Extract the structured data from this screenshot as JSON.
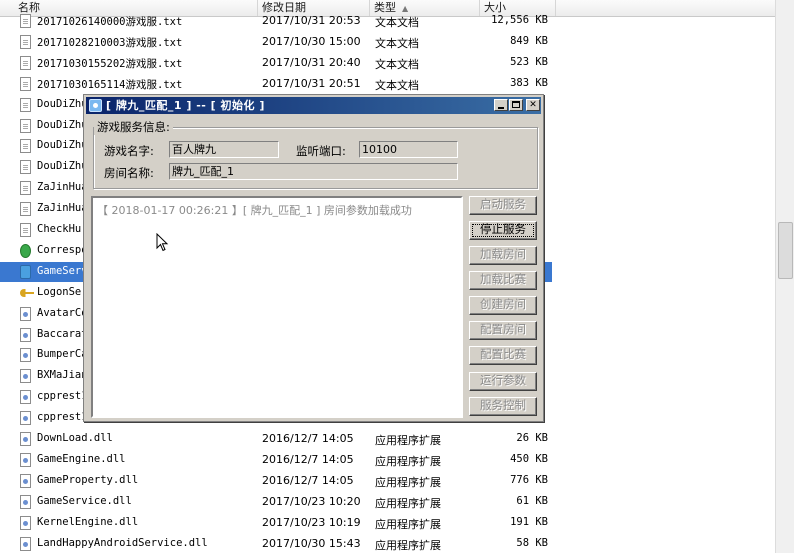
{
  "explorer": {
    "columns": {
      "name": "名称",
      "date": "修改日期",
      "type": "类型",
      "size": "大小"
    },
    "sort_indicator": "▲",
    "rows": [
      {
        "name": "20171026140000游戏服.txt",
        "date": "2017/10/31 20:53",
        "type": "文本文档",
        "size": "12,556 KB",
        "icon": "text-file-icon"
      },
      {
        "name": "20171028210003游戏服.txt",
        "date": "2017/10/30 15:00",
        "type": "文本文档",
        "size": "849 KB",
        "icon": "text-file-icon"
      },
      {
        "name": "20171030155202游戏服.txt",
        "date": "2017/10/31 20:40",
        "type": "文本文档",
        "size": "523 KB",
        "icon": "text-file-icon"
      },
      {
        "name": "20171030165114游戏服.txt",
        "date": "2017/10/31 20:51",
        "type": "文本文档",
        "size": "383 KB",
        "icon": "text-file-icon"
      },
      {
        "name": "DouDiZhu",
        "date": "",
        "type": "",
        "size": "",
        "icon": "text-file-icon"
      },
      {
        "name": "DouDiZhu",
        "date": "",
        "type": "",
        "size": "",
        "icon": "text-file-icon"
      },
      {
        "name": "DouDiZhu",
        "date": "",
        "type": "",
        "size": "",
        "icon": "text-file-icon"
      },
      {
        "name": "DouDiZhu",
        "date": "",
        "type": "",
        "size": "",
        "icon": "text-file-icon"
      },
      {
        "name": "ZaJinHua",
        "date": "",
        "type": "",
        "size": "",
        "icon": "text-file-icon"
      },
      {
        "name": "ZaJinHua",
        "date": "",
        "type": "",
        "size": "",
        "icon": "text-file-icon"
      },
      {
        "name": "CheckHu",
        "date": "",
        "type": "",
        "size": "",
        "icon": "text-file-icon"
      },
      {
        "name": "Correspo",
        "date": "",
        "type": "",
        "size": "",
        "icon": "green-app-icon"
      },
      {
        "name": "GameServ",
        "date": "",
        "type": "",
        "size": "",
        "icon": "gameserver-exe-icon",
        "selected": true
      },
      {
        "name": "LogonSer",
        "date": "",
        "type": "",
        "size": "",
        "icon": "key-icon"
      },
      {
        "name": "AvatarCo",
        "date": "",
        "type": "",
        "size": "",
        "icon": "dll-file-icon"
      },
      {
        "name": "Baccarat",
        "date": "",
        "type": "",
        "size": "",
        "icon": "dll-file-icon"
      },
      {
        "name": "BumperCa",
        "date": "",
        "type": "",
        "size": "",
        "icon": "dll-file-icon"
      },
      {
        "name": "BXMaJian",
        "date": "",
        "type": "",
        "size": "",
        "icon": "dll-file-icon"
      },
      {
        "name": "cpprest1",
        "date": "",
        "type": "",
        "size": "",
        "icon": "dll-file-icon"
      },
      {
        "name": "cpprest1",
        "date": "",
        "type": "",
        "size": "",
        "icon": "dll-file-icon"
      },
      {
        "name": "DownLoad.dll",
        "date": "2016/12/7 14:05",
        "type": "应用程序扩展",
        "size": "26 KB",
        "icon": "dll-file-icon"
      },
      {
        "name": "GameEngine.dll",
        "date": "2016/12/7 14:05",
        "type": "应用程序扩展",
        "size": "450 KB",
        "icon": "dll-file-icon"
      },
      {
        "name": "GameProperty.dll",
        "date": "2016/12/7 14:05",
        "type": "应用程序扩展",
        "size": "776 KB",
        "icon": "dll-file-icon"
      },
      {
        "name": "GameService.dll",
        "date": "2017/10/23 10:20",
        "type": "应用程序扩展",
        "size": "61 KB",
        "icon": "dll-file-icon"
      },
      {
        "name": "KernelEngine.dll",
        "date": "2017/10/23 10:19",
        "type": "应用程序扩展",
        "size": "191 KB",
        "icon": "dll-file-icon"
      },
      {
        "name": "LandHappyAndroidService.dll",
        "date": "2017/10/30 15:43",
        "type": "应用程序扩展",
        "size": "58 KB",
        "icon": "dll-file-icon"
      }
    ]
  },
  "dialog": {
    "title": "[ 牌九_匹配_1 ] -- [ 初始化 ]",
    "group_title": "游戏服务信息:",
    "labels": {
      "game_name": "游戏名字:",
      "port": "监听端口:",
      "room_name": "房间名称:"
    },
    "values": {
      "game_name": "百人牌九",
      "port": "10100",
      "room_name": "牌九_匹配_1"
    },
    "log": [
      "【 2018-01-17 00:26:21 】[ 牌九_匹配_1 ] 房间参数加载成功"
    ],
    "buttons": [
      {
        "label": "启动服务",
        "enabled": false
      },
      {
        "label": "停止服务",
        "enabled": true
      },
      {
        "label": "加载房间",
        "enabled": false
      },
      {
        "label": "加载比赛",
        "enabled": false
      },
      {
        "label": "创建房间",
        "enabled": false
      },
      {
        "label": "配置房间",
        "enabled": false
      },
      {
        "label": "配置比赛",
        "enabled": false
      },
      {
        "label": "运行参数",
        "enabled": false
      },
      {
        "label": "服务控制",
        "enabled": false
      }
    ]
  },
  "icons": {
    "minimize": "minimize-icon",
    "maximize": "maximize-icon",
    "close": "close-icon",
    "cursor": "mouse-pointer-icon"
  }
}
